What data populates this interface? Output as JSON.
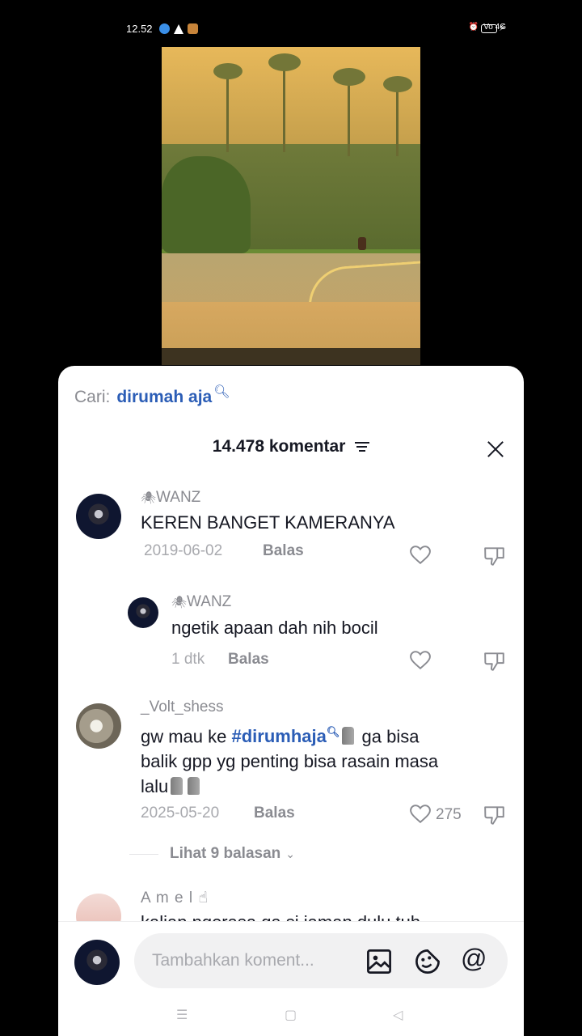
{
  "status_bar": {
    "time": "12.52",
    "signal": "Vo 4G"
  },
  "search": {
    "label": "Cari:",
    "term": "dirumah aja"
  },
  "header": {
    "title": "14.478 komentar"
  },
  "comments": [
    {
      "user": "WANZ",
      "text": "KEREN BANGET KAMERANYA",
      "date": "2019-06-02",
      "reply_label": "Balas"
    },
    {
      "user": "WANZ",
      "text": "ngetik apaan dah nih bocil",
      "date": "1 dtk",
      "reply_label": "Balas"
    },
    {
      "user": "_Volt_shess",
      "text_before_tag": "gw mau ke ",
      "hashtag": "#dirumhaja",
      "text_after_tag": " ga bisa",
      "line2": "balik gpp yg penting bisa rasain masa",
      "line3": "lalu",
      "date": "2025-05-20",
      "reply_label": "Balas",
      "likes": "275"
    },
    {
      "user": "A m e l",
      "text": "kalian ngerasa ga si jaman dulu tuh"
    }
  ],
  "view_replies": "Lihat 9 balasan",
  "input": {
    "placeholder": "Tambahkan koment..."
  },
  "icons": [
    "image-icon",
    "emoji-icon",
    "mention-icon",
    "heart-icon",
    "dislike-icon",
    "filter-icon",
    "close-icon",
    "search-icon"
  ]
}
